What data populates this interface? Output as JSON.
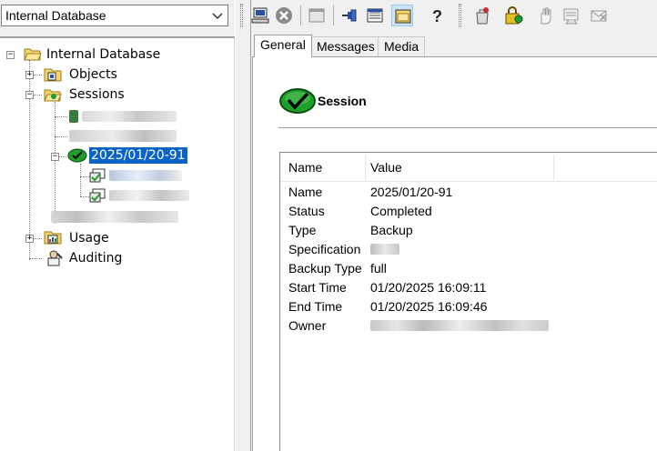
{
  "context_selector": {
    "value": "Internal Database"
  },
  "tree": {
    "root": "Internal Database",
    "objects": "Objects",
    "sessions": "Sessions",
    "selected_session": "2025/01/20-91",
    "usage": "Usage",
    "auditing": "Auditing"
  },
  "tabs": [
    {
      "label": "General"
    },
    {
      "label": "Messages"
    },
    {
      "label": "Media"
    }
  ],
  "header": {
    "title": "Session"
  },
  "properties": {
    "columns": [
      "Name",
      "Value"
    ],
    "rows": [
      {
        "key": "Name",
        "value": "2025/01/20-91"
      },
      {
        "key": "Status",
        "value": "Completed"
      },
      {
        "key": "Type",
        "value": "Backup"
      },
      {
        "key": "Specification",
        "value": ""
      },
      {
        "key": "Backup Type",
        "value": "full"
      },
      {
        "key": "Start Time",
        "value": "01/20/2025 16:09:11"
      },
      {
        "key": "End Time",
        "value": "01/20/2025 16:09:46"
      },
      {
        "key": "Owner",
        "value": ""
      }
    ]
  },
  "colors": {
    "selection": "#0a64c8",
    "check_green": "#1e9e2a",
    "folder_yellow": "#f5d36b"
  }
}
